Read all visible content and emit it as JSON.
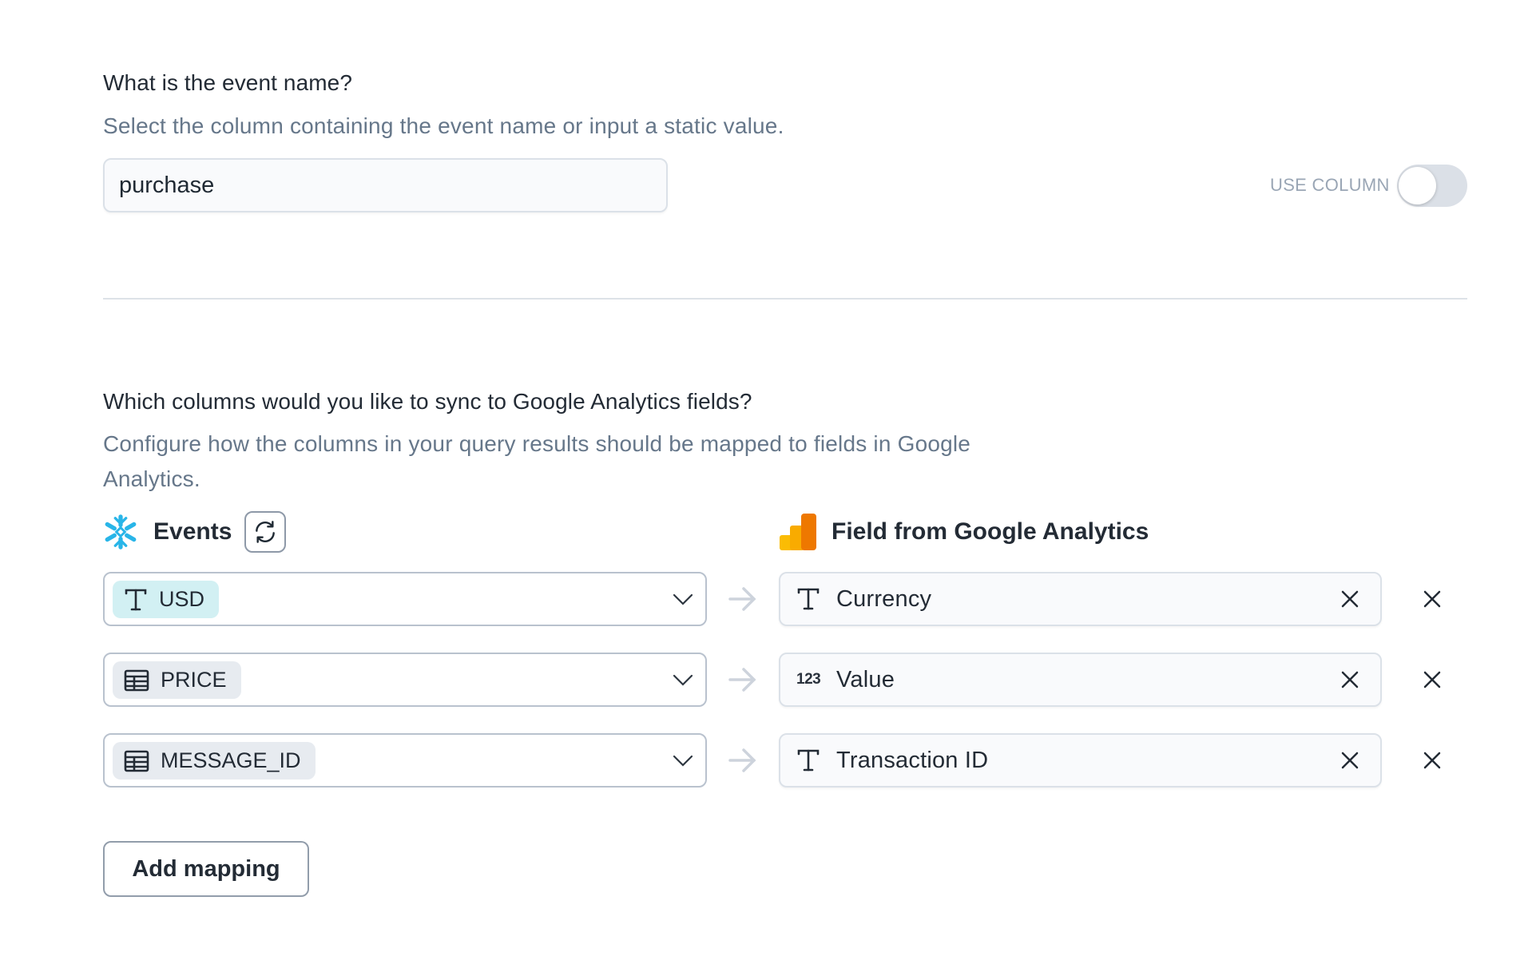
{
  "event_name": {
    "title": "What is the event name?",
    "description": "Select the column containing the event name or input a static value.",
    "input_value": "purchase",
    "toggle_label": "USE COLUMN",
    "use_column_enabled": false
  },
  "mapping": {
    "title": "Which columns would you like to sync to Google Analytics fields?",
    "description": "Configure how the columns in your query results should be mapped to fields in Google Analytics.",
    "source_header": "Events",
    "source_icon": "snowflake-icon",
    "destination_header": "Field from Google Analytics",
    "destination_icon": "google-analytics-icon",
    "rows": [
      {
        "source_column": "USD",
        "source_type": "text-icon",
        "destination_field": "Currency",
        "destination_type": "text-icon"
      },
      {
        "source_column": "PRICE",
        "source_type": "table-column-icon",
        "destination_field": "Value",
        "destination_type": "number-icon",
        "destination_type_glyph": "123"
      },
      {
        "source_column": "MESSAGE_ID",
        "source_type": "table-column-icon",
        "destination_field": "Transaction ID",
        "destination_type": "text-icon"
      }
    ],
    "add_button_label": "Add mapping"
  },
  "colors": {
    "teal_chip": "#d2f0f3",
    "gray_chip": "#e7ebf0",
    "snowflake_blue": "#29b5e8",
    "ga_yellow": "#f9ab00",
    "ga_orange": "#e37400"
  }
}
